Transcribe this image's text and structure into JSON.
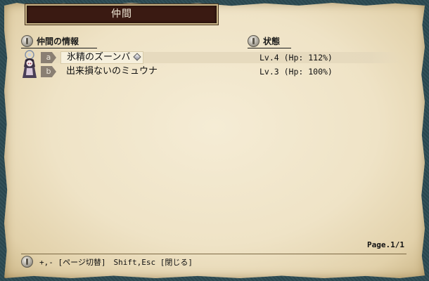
{
  "window": {
    "title": "仲間"
  },
  "headers": {
    "party_info": "仲間の情報",
    "status": "状態"
  },
  "members": [
    {
      "key": "a",
      "name": "氷精のズーンバ",
      "status": "Lv.4 (Hp: 112%)",
      "selected": true,
      "icon": "diamond-icon"
    },
    {
      "key": "b",
      "name": "出来損ないのミュウナ",
      "status": "Lv.3 (Hp: 100%)",
      "selected": false
    }
  ],
  "page": "Page.1/1",
  "help": "+,- [ページ切替]　Shift,Esc [閉じる]"
}
